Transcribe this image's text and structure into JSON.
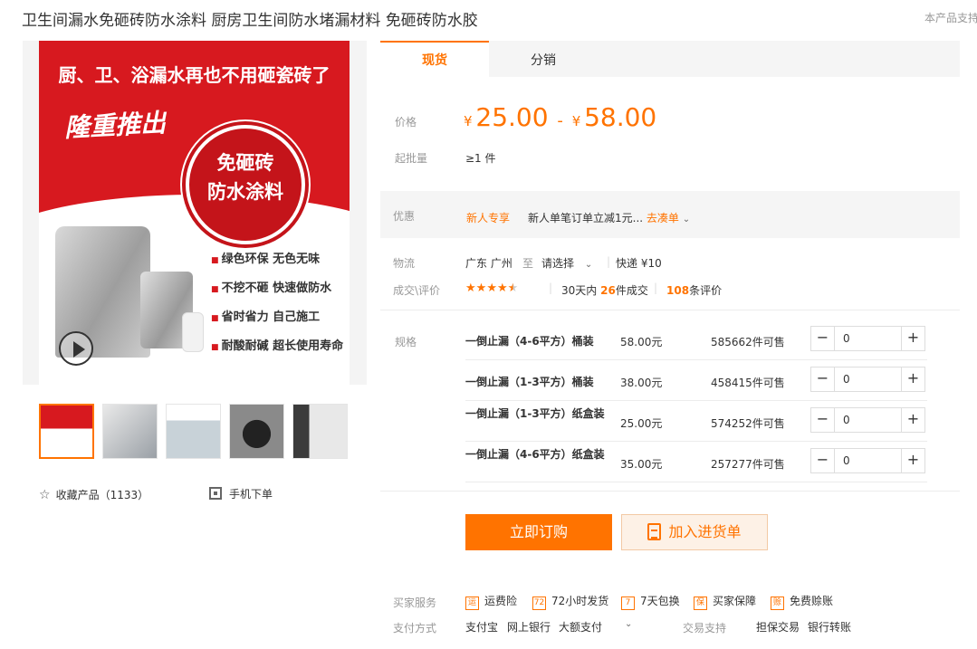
{
  "product": {
    "title": "卫生间漏水免砸砖防水涂料 厨房卫生间防水堵漏材料 免砸砖防水胶",
    "support_note": "本产品支持"
  },
  "gallery": {
    "poster": {
      "headline": "厨、卫、浴漏水再也不用砸瓷砖了",
      "promo": "隆重推出",
      "seal_line1": "免砸砖",
      "seal_line2": "防水涂料",
      "features": [
        "绿色环保 无色无味",
        "不挖不砸 快速做防水",
        "省时省力 自己施工",
        "耐酸耐碱 超长使用寿命"
      ]
    },
    "thumb_count": 5,
    "favorite_label": "收藏产品",
    "favorite_count": "（1133）",
    "mobile_order_label": "手机下单"
  },
  "tabs": [
    {
      "label": "现货"
    },
    {
      "label": "分销"
    }
  ],
  "pricing": {
    "price_label": "价格",
    "currency": "¥",
    "min_price": "25.00",
    "max_price": "58.00",
    "moq_label": "起批量",
    "moq_value": "≥1 件"
  },
  "promotion": {
    "label": "优惠",
    "tag": "新人专享",
    "text": "新人单笔订单立减1元...",
    "link": "去凑单"
  },
  "logistics": {
    "label": "物流",
    "origin": "广东 广州",
    "to": "至",
    "destination": "请选择",
    "shipping": "快递 ¥10"
  },
  "reviews": {
    "label": "成交\\评价",
    "rating": 4.5,
    "period": "30天内",
    "deals": "26",
    "deals_suffix": "件成交",
    "review_count": "108",
    "review_suffix": "条评价"
  },
  "sku": {
    "label": "规格",
    "rows": [
      {
        "name": "一倒止漏（4-6平方）桶装",
        "price": "58.00元",
        "stock": "585662件可售",
        "qty": "0"
      },
      {
        "name": "一倒止漏（1-3平方）桶装",
        "price": "38.00元",
        "stock": "458415件可售",
        "qty": "0"
      },
      {
        "name": "一倒止漏（1-3平方）纸盒装",
        "price": "25.00元",
        "stock": "574252件可售",
        "qty": "0"
      },
      {
        "name": "一倒止漏（4-6平方）纸盒装",
        "price": "35.00元",
        "stock": "257277件可售",
        "qty": "0"
      }
    ]
  },
  "actions": {
    "buy_now": "立即订购",
    "add_to_cart": "加入进货单"
  },
  "services": {
    "buyer_label": "买家服务",
    "items": [
      {
        "icon": "运",
        "label": "运费险"
      },
      {
        "icon": "72",
        "label": "72小时发货"
      },
      {
        "icon": "7",
        "label": "7天包换"
      },
      {
        "icon": "保",
        "label": "买家保障"
      },
      {
        "icon": "赊",
        "label": "免费赊账"
      }
    ],
    "payment_label": "支付方式",
    "payments": [
      "支付宝",
      "网上银行",
      "大额支付"
    ],
    "trade_label": "交易支持",
    "trade_items": [
      "担保交易",
      "银行转账"
    ]
  },
  "colors": {
    "accent": "#ff7300",
    "poster_red": "#d7191f",
    "tab_bg": "#f5f5f5"
  }
}
